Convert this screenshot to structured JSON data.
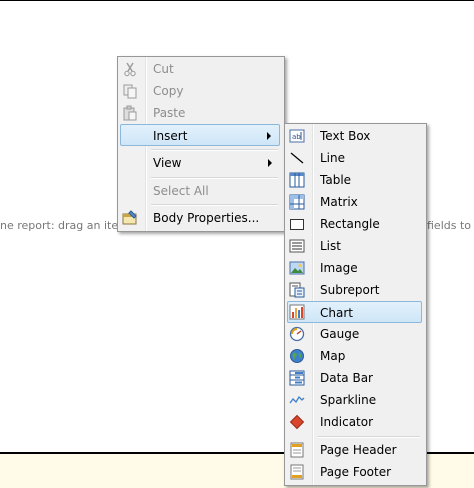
{
  "background": {
    "hint_left": "ne report: drag an item f",
    "hint_right": "fields to th"
  },
  "context_menu": {
    "items": [
      {
        "label": "Cut",
        "icon": "scissors-icon",
        "enabled": false
      },
      {
        "label": "Copy",
        "icon": "copy-icon",
        "enabled": false
      },
      {
        "label": "Paste",
        "icon": "paste-icon",
        "enabled": false
      },
      {
        "label": "Insert",
        "enabled": true,
        "submenu": true,
        "highlighted": true
      },
      {
        "label": "View",
        "enabled": true,
        "submenu": true
      },
      {
        "label": "Select All",
        "enabled": false
      },
      {
        "label": "Body Properties...",
        "icon": "properties-icon",
        "enabled": true
      }
    ]
  },
  "insert_submenu": {
    "items": [
      {
        "label": "Text Box",
        "icon": "textbox-icon"
      },
      {
        "label": "Line",
        "icon": "line-icon"
      },
      {
        "label": "Table",
        "icon": "table-icon"
      },
      {
        "label": "Matrix",
        "icon": "matrix-icon"
      },
      {
        "label": "Rectangle",
        "icon": "rectangle-icon"
      },
      {
        "label": "List",
        "icon": "list-icon"
      },
      {
        "label": "Image",
        "icon": "image-icon"
      },
      {
        "label": "Subreport",
        "icon": "subreport-icon"
      },
      {
        "label": "Chart",
        "icon": "chart-icon",
        "highlighted": true
      },
      {
        "label": "Gauge",
        "icon": "gauge-icon"
      },
      {
        "label": "Map",
        "icon": "map-icon"
      },
      {
        "label": "Data Bar",
        "icon": "databar-icon"
      },
      {
        "label": "Sparkline",
        "icon": "sparkline-icon"
      },
      {
        "label": "Indicator",
        "icon": "indicator-icon"
      },
      {
        "label": "Page Header",
        "icon": "page-header-icon"
      },
      {
        "label": "Page Footer",
        "icon": "page-footer-icon"
      }
    ]
  },
  "colors": {
    "menu_background": "#f0f0f0",
    "highlight_fill": "#cfe6f8",
    "highlight_border": "#8cb8dc",
    "disabled_text": "#8d8d8d",
    "footer_band": "#fffbe8"
  }
}
